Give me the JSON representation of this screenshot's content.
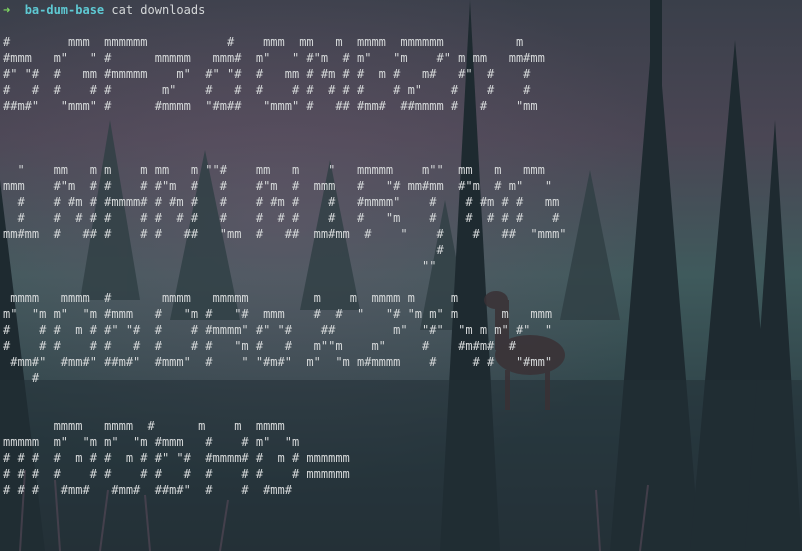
{
  "prompt": {
    "arrow": "➜",
    "directory": "ba-dum-base",
    "command": "cat downloads"
  },
  "output": {
    "block1": [
      "#        mmm  mmmmmm           #    mmm  mm   m  mmmm  mmmmmm          m",
      "#mmm   m\"   \" #      mmmmm   mmm#  m\"   \" #\"m  # m\"   \"m    #\" m mm   mm#mm",
      "#\" \"#  #   mm #mmmmm    m\"  #\" \"#  #   mm # #m # #  m #   m#   #\"  #    #",
      "#   #  #    # #       m\"    #   #  #    # #  # # #    # m\"    #    #    #",
      "##m#\"   \"mmm\" #      #mmmm  \"#m##   \"mmm\" #   ## #mm#  ##mmmm #   #    \"mm"
    ],
    "block2": [
      "  \"    mm   m m    m mm   m \"\"#    mm   m    \"   mmmmm    m\"\"  mm   m   mmm",
      "mmm    #\"m  # #    # #\"m  #   #    #\"m  #  mmm   #   \"# mm#mm  #\"m  # m\"   \"",
      "  #    # #m # #mmmm# # #m #   #    # #m #    #   #mmmm\"    #    # #m # #   mm",
      "  #    #  # # #    # #  # #   #    #  # #    #   #   \"m    #    #  # # #    #",
      "mm#mm  #   ## #    # #   ##   \"mm  #   ##  mm#mm  #    \"    #    #   ##  \"mmm\"",
      "                                                            #",
      "                                                          \"\""
    ],
    "block3": [
      " mmmm   mmmm  #       mmmm   mmmmm         m    m  mmmm m     m",
      "m\"  \"m m\"  \"m #mmm   #   \"m #   \"#  mmm    #  #  \"   \"# \"m m\" m      m   mmm",
      "#    # #  m # #\" \"#  #    # #mmmm\" #\" \"#    ##        m\"  \"#\"  \"m m m\" #\"  \"",
      "#    # #    # #   #  #    # #   \"m #   #   m\"\"m    m\"     #    #m#m#  #",
      " #mm#\"  #mm#\" ##m#\"  #mmm\"  #    \" \"#m#\"  m\"  \"m m#mmmm    #     # #   \"#mm\"",
      "    #"
    ],
    "block4": [
      "       mmmm   mmmm  #      m    m  mmmm",
      "mmmmm  m\"  \"m m\"  \"m #mmm   #    # m\"  \"m",
      "# # #  #  m # #  m # #\" \"#  #mmmm# #  m # mmmmmm",
      "# # #  #    # #    # #   #  #    # #    # mmmmmm",
      "# # #   #mm#   #mm#  ##m#\"  #    #  #mm#"
    ]
  },
  "colors": {
    "prompt_arrow": "#7fd962",
    "prompt_dir": "#5ec9d3",
    "text": "#d4d7d8"
  }
}
